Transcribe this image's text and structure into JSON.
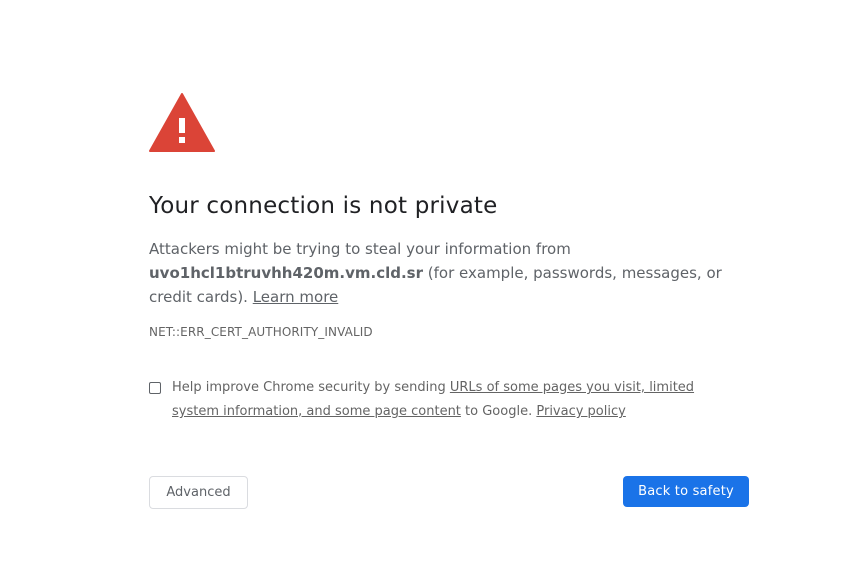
{
  "page": {
    "title": "Your connection is not private",
    "explanation": {
      "before_host": "Attackers might be trying to steal your information from ",
      "hostname": "uvo1hcl1btruvhh420m.vm.cld.sr",
      "after_host": " (for example, passwords, messages, or credit cards). ",
      "learn_more": "Learn more"
    },
    "error_code": "NET::ERR_CERT_AUTHORITY_INVALID",
    "opt_in": {
      "prefix": "Help improve Chrome security by sending ",
      "link_text": "URLs of some pages you visit, limited system information, and some page content",
      "middle": " to Google. ",
      "privacy_link": "Privacy policy",
      "checked": false
    },
    "buttons": {
      "advanced": "Advanced",
      "back_to_safety": "Back to safety"
    }
  },
  "colors": {
    "warning_icon": "#db4437",
    "primary_button": "#1a73e8",
    "title_text": "#202124",
    "body_text": "#5f6368"
  },
  "icons": {
    "warning": "warning-triangle-icon"
  }
}
